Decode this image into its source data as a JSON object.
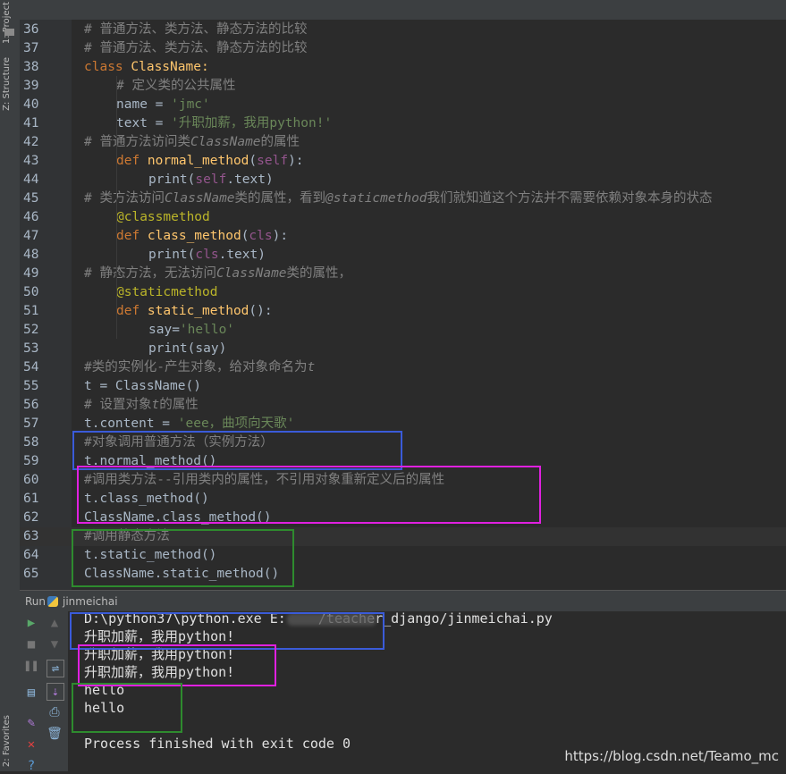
{
  "left_tabs": {
    "project": "1: Project",
    "structure": "Z: Structure",
    "favorites": "2: Favorites"
  },
  "editor": {
    "lines": [
      {
        "n": "36",
        "indent": 0,
        "tokens": [
          {
            "c": "cm",
            "t": "# 普通方法、类方法、静态方法的比较"
          }
        ]
      },
      {
        "n": "37",
        "indent": 0,
        "tokens": [
          {
            "c": "cm",
            "t": "# 普通方法、类方法、静态方法的比较"
          }
        ]
      },
      {
        "n": "38",
        "indent": 0,
        "tokens": [
          {
            "c": "kw",
            "t": "class "
          },
          {
            "c": "cls",
            "t": "ClassName:"
          }
        ]
      },
      {
        "n": "39",
        "indent": 1,
        "tokens": [
          {
            "c": "cm",
            "t": "# 定义类的公共属性"
          }
        ]
      },
      {
        "n": "40",
        "indent": 1,
        "tokens": [
          {
            "c": "",
            "t": "name = "
          },
          {
            "c": "str",
            "t": "'jmc'"
          }
        ]
      },
      {
        "n": "41",
        "indent": 1,
        "tokens": [
          {
            "c": "",
            "t": "text = "
          },
          {
            "c": "str",
            "t": "'升职加薪，我用python!'"
          }
        ]
      },
      {
        "n": "42",
        "indent": 0,
        "tokens": [
          {
            "c": "cm",
            "t": "# 普通方法访问类"
          },
          {
            "c": "cmi",
            "t": "ClassName"
          },
          {
            "c": "cm",
            "t": "的属性"
          }
        ]
      },
      {
        "n": "43",
        "indent": 1,
        "tokens": [
          {
            "c": "kw",
            "t": "def "
          },
          {
            "c": "fn",
            "t": "normal_method"
          },
          {
            "c": "",
            "t": "("
          },
          {
            "c": "slf",
            "t": "self"
          },
          {
            "c": "",
            "t": "):"
          }
        ]
      },
      {
        "n": "44",
        "indent": 2,
        "tokens": [
          {
            "c": "",
            "t": "print("
          },
          {
            "c": "slf",
            "t": "self"
          },
          {
            "c": "",
            "t": ".text)"
          }
        ]
      },
      {
        "n": "45",
        "indent": 0,
        "tokens": [
          {
            "c": "cm",
            "t": "# 类方法访问"
          },
          {
            "c": "cmi",
            "t": "ClassName"
          },
          {
            "c": "cm",
            "t": "类的属性，看到"
          },
          {
            "c": "cmi",
            "t": "@staticmethod"
          },
          {
            "c": "cm",
            "t": "我们就知道这个方法并不需要依赖对象本身的状态"
          }
        ]
      },
      {
        "n": "46",
        "indent": 1,
        "tokens": [
          {
            "c": "dec",
            "t": "@classmethod"
          }
        ]
      },
      {
        "n": "47",
        "indent": 1,
        "tokens": [
          {
            "c": "kw",
            "t": "def "
          },
          {
            "c": "fn",
            "t": "class_method"
          },
          {
            "c": "",
            "t": "("
          },
          {
            "c": "slf",
            "t": "cls"
          },
          {
            "c": "",
            "t": "):"
          }
        ]
      },
      {
        "n": "48",
        "indent": 2,
        "tokens": [
          {
            "c": "",
            "t": "print("
          },
          {
            "c": "slf",
            "t": "cls"
          },
          {
            "c": "",
            "t": ".text)"
          }
        ]
      },
      {
        "n": "49",
        "indent": 0,
        "tokens": [
          {
            "c": "cm",
            "t": "# 静态方法，无法访问"
          },
          {
            "c": "cmi",
            "t": "ClassName"
          },
          {
            "c": "cm",
            "t": "类的属性，"
          }
        ]
      },
      {
        "n": "50",
        "indent": 1,
        "tokens": [
          {
            "c": "dec",
            "t": "@staticmethod"
          }
        ]
      },
      {
        "n": "51",
        "indent": 1,
        "tokens": [
          {
            "c": "kw",
            "t": "def "
          },
          {
            "c": "fn",
            "t": "static_method"
          },
          {
            "c": "",
            "t": "():"
          }
        ]
      },
      {
        "n": "52",
        "indent": 2,
        "tokens": [
          {
            "c": "",
            "t": "say="
          },
          {
            "c": "str",
            "t": "'hello'"
          }
        ]
      },
      {
        "n": "53",
        "indent": 2,
        "tokens": [
          {
            "c": "",
            "t": "print(say)"
          }
        ]
      },
      {
        "n": "54",
        "indent": 0,
        "tokens": [
          {
            "c": "cm",
            "t": "#类的实例化-产生对象，给对象命名为"
          },
          {
            "c": "cmi",
            "t": "t"
          }
        ]
      },
      {
        "n": "55",
        "indent": 0,
        "tokens": [
          {
            "c": "",
            "t": "t = ClassName()"
          }
        ]
      },
      {
        "n": "56",
        "indent": 0,
        "tokens": [
          {
            "c": "cm",
            "t": "# 设置对象"
          },
          {
            "c": "cmi",
            "t": "t"
          },
          {
            "c": "cm",
            "t": "的属性"
          }
        ]
      },
      {
        "n": "57",
        "indent": 0,
        "tokens": [
          {
            "c": "",
            "t": "t.content = "
          },
          {
            "c": "str",
            "t": "'eee，曲项向天歌'"
          }
        ]
      },
      {
        "n": "58",
        "indent": 0,
        "tokens": [
          {
            "c": "cm",
            "t": "#对象调用普通方法（实例方法）"
          }
        ]
      },
      {
        "n": "59",
        "indent": 0,
        "tokens": [
          {
            "c": "",
            "t": "t.normal_method()"
          }
        ]
      },
      {
        "n": "60",
        "indent": 0,
        "tokens": [
          {
            "c": "cm",
            "t": "#调用类方法--引用类内的属性，不引用对象重新定义后的属性"
          }
        ]
      },
      {
        "n": "61",
        "indent": 0,
        "tokens": [
          {
            "c": "",
            "t": "t.class_method()"
          }
        ]
      },
      {
        "n": "62",
        "indent": 0,
        "tokens": [
          {
            "c": "",
            "t": "ClassName.class_method()"
          }
        ]
      },
      {
        "n": "63",
        "indent": 0,
        "tokens": [
          {
            "c": "cm",
            "t": "#调用静态方法"
          }
        ]
      },
      {
        "n": "64",
        "indent": 0,
        "tokens": [
          {
            "c": "",
            "t": "t.static_method()"
          }
        ]
      },
      {
        "n": "65",
        "indent": 0,
        "tokens": [
          {
            "c": "",
            "t": "ClassName.static_method()"
          }
        ]
      }
    ]
  },
  "run": {
    "tab_label": "Run",
    "config_name": "jinmeichai",
    "console": [
      "D:\\python37\\python.exe E:    /teacher_django/jinmeichai.py",
      "升职加薪，我用python!",
      "升职加薪，我用python!",
      "升职加薪，我用python!",
      "hello",
      "hello",
      "",
      "Process finished with exit code 0"
    ]
  },
  "watermark": "https://blog.csdn.net/Teamo_mc",
  "colors": {
    "blue_box": "#3a5bd9",
    "magenta_box": "#e020e0",
    "green_box": "#2e8b2e"
  }
}
